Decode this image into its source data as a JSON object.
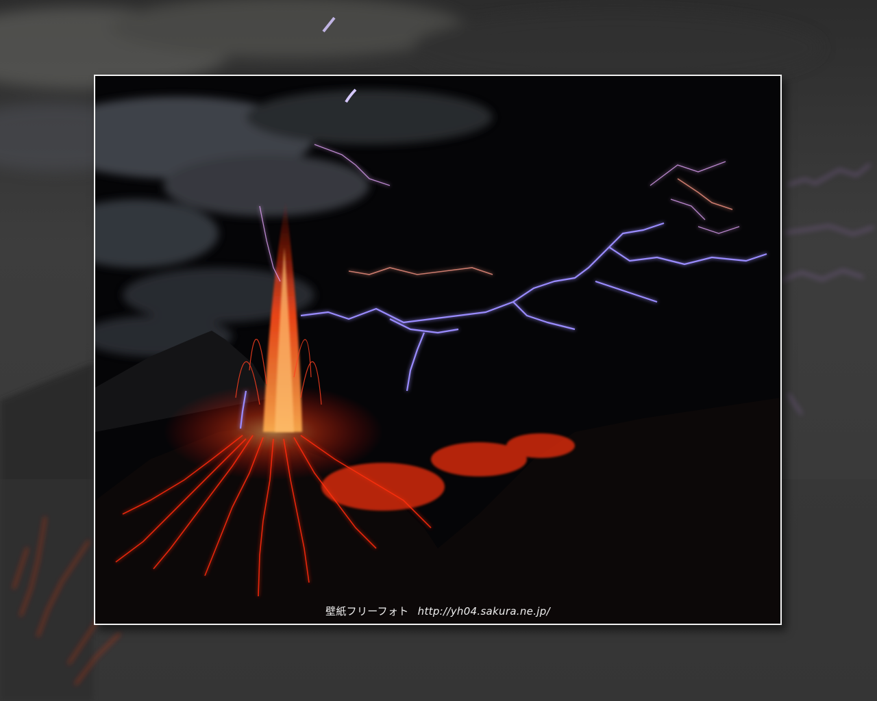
{
  "wallpaper": {
    "caption_title": "壁紙フリーフォト",
    "caption_url": "http://yh04.sakura.ne.jp/"
  },
  "scene": {
    "subject": "volcanic-eruption-with-lightning",
    "colors": {
      "background": "#3a3a3a",
      "frame": "#f2f2f2",
      "lava": "#ff3a10",
      "lightning": "#9a8cff",
      "sky": "#050507"
    }
  }
}
